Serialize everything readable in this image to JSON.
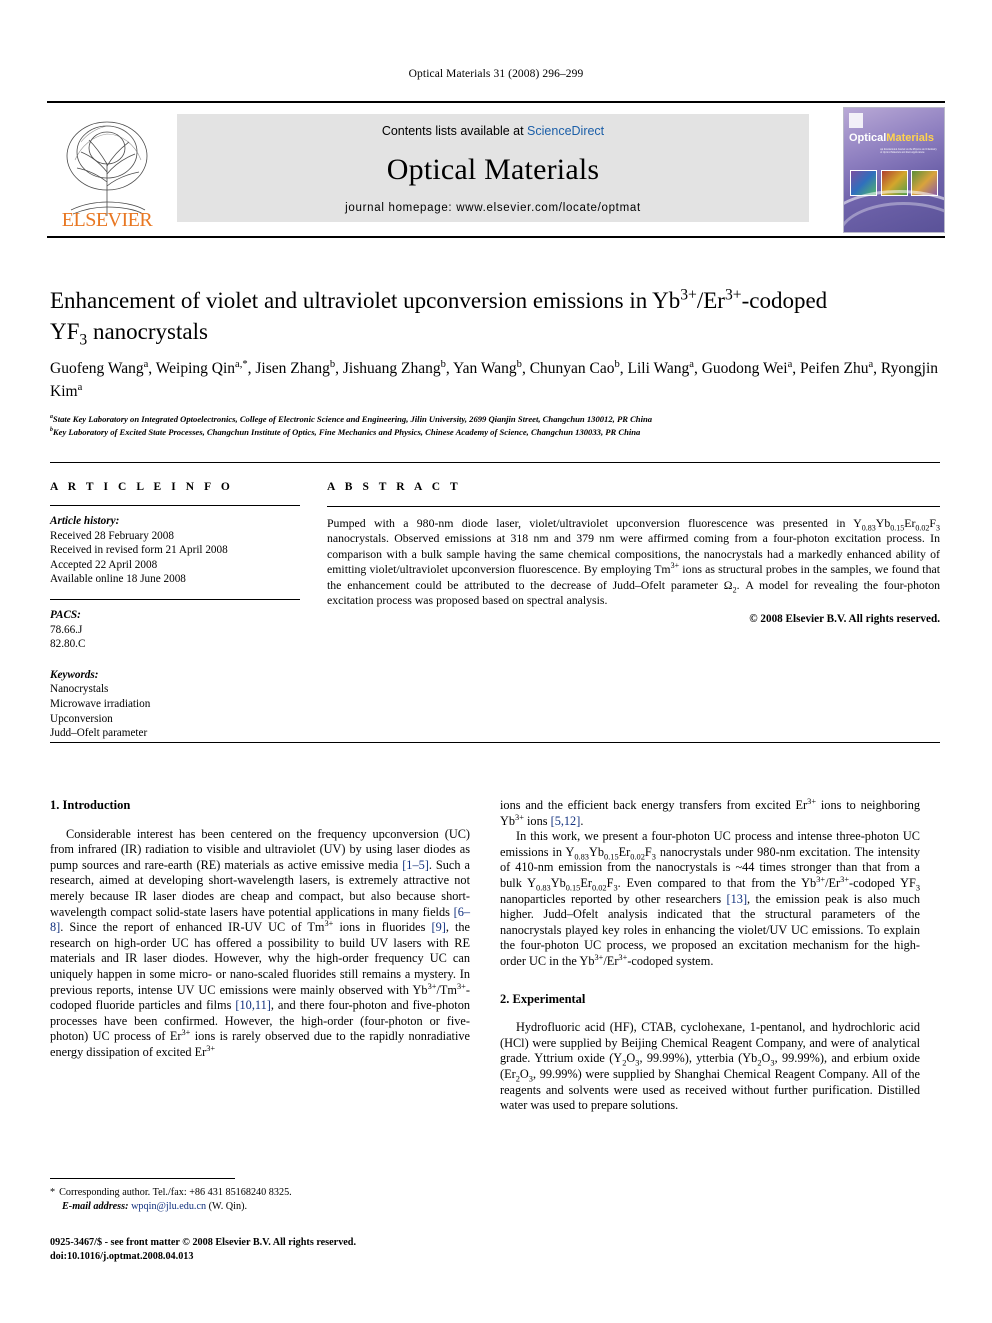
{
  "running_head": "Optical Materials 31 (2008) 296–299",
  "banner": {
    "contents_prefix": "Contents lists available at ",
    "sciencedirect": "ScienceDirect",
    "journal_name": "Optical Materials",
    "homepage": "journal homepage: www.elsevier.com/locate/optmat",
    "publisher_wordmark": "ELSEVIER",
    "cover": {
      "title_word1": "Optical",
      "title_word2": "Materials",
      "subtitle": "An International Journal on the Physics and Chemistry of Optical Materials and their Applications"
    },
    "colors": {
      "sciencedirect_blue": "#1c5fa8",
      "elsevier_orange": "#e87722",
      "contents_box_gray": "#e3e3e3",
      "cover_purple": "#6f63ab",
      "cover_yellow": "#ffd34d"
    }
  },
  "article": {
    "title_line1_a": "Enhancement of violet and ultraviolet upconversion emissions in Yb",
    "title_sup1": "3+",
    "title_line1_b": "/Er",
    "title_sup2": "3+",
    "title_line1_c": "-codoped",
    "title_line2_a": "YF",
    "title_sub1": "3",
    "title_line2_b": " nanocrystals",
    "authors": "Guofeng Wang a, Weiping Qin a,*, Jisen Zhang b, Jishuang Zhang b, Yan Wang b, Chunyan Cao b, Lili Wang a, Guodong Wei a, Peifen Zhu a, Ryongjin Kim a",
    "affiliation_a": "State Key Laboratory on Integrated Optoelectronics, College of Electronic Science and Engineering, Jilin University, 2699 Qianjin Street, Changchun 130012, PR China",
    "affiliation_b": "Key Laboratory of Excited State Processes, Changchun Institute of Optics, Fine Mechanics and Physics, Chinese Academy of Science, Changchun 130033, PR China",
    "affiliation_a_mark": "a",
    "affiliation_b_mark": "b"
  },
  "article_info": {
    "heading": "A R T I C L E   I N F O",
    "history_label": "Article history:",
    "history": [
      "Received 28 February 2008",
      "Received in revised form 21 April 2008",
      "Accepted 22 April 2008",
      "Available online 18 June 2008"
    ],
    "pacs_label": "PACS:",
    "pacs": [
      "78.66.J",
      "82.80.C"
    ],
    "keywords_label": "Keywords:",
    "keywords": [
      "Nanocrystals",
      "Microwave irradiation",
      "Upconversion",
      "Judd–Ofelt parameter"
    ]
  },
  "abstract": {
    "heading": "A B S T R A C T",
    "p1": "Pumped with a 980-nm diode laser, violet/ultraviolet upconversion fluorescence was presented in Y0.83Yb0.15Er0.02F3 nanocrystals. Observed emissions at 318 nm and 379 nm were affirmed coming from a four-photon excitation process. In comparison with a bulk sample having the same chemical compositions, the nanocrystals had a markedly enhanced ability of emitting violet/ultraviolet upconversion fluorescence. By employing Tm3+ ions as structural probes in the samples, we found that the enhancement could be attributed to the decrease of Judd–Ofelt parameter Ω2. A model for revealing the four-photon excitation process was proposed based on spectral analysis.",
    "copyright": "© 2008 Elsevier B.V. All rights reserved."
  },
  "sections": {
    "intro_heading": "1. Introduction",
    "intro_p1": "Considerable interest has been centered on the frequency upconversion (UC) from infrared (IR) radiation to visible and ultraviolet (UV) by using laser diodes as pump sources and rare-earth (RE) materials as active emissive media [1–5]. Such a research, aimed at developing short-wavelength lasers, is extremely attractive not merely because IR laser diodes are cheap and compact, but also because short-wavelength compact solid-state lasers have potential applications in many fields [6–8]. Since the report of enhanced IR-UV UC of Tm3+ ions in fluorides [9], the research on high-order UC has offered a possibility to build UV lasers with RE materials and IR laser diodes. However, why the high-order frequency UC can uniquely happen in some micro- or nano-scaled fluorides still remains a mystery. In previous reports, intense UV UC emissions were mainly observed with Yb3+/Tm3+-codoped fluoride particles and films [10,11], and there four-photon and five-photon processes have been confirmed. However, the high-order (four-photon or five-photon) UC process of Er3+ ions is rarely observed due to the rapidly nonradiative energy dissipation of excited Er3+ ions and the efficient back energy transfers from excited Er3+ ions to neighboring Yb3+ ions [5,12].",
    "intro_p2": "In this work, we present a four-photon UC process and intense three-photon UC emissions in Y0.83Yb0.15Er0.02F3 nanocrystals under 980-nm excitation. The intensity of 410-nm emission from the nanocrystals is ~44 times stronger than that from a bulk Y0.83Yb0.15Er0.02F3. Even compared to that from the Yb3+/Er3+-codoped YF3 nanoparticles reported by other researchers [13], the emission peak is also much higher. Judd–Ofelt analysis indicated that the structural parameters of the nanocrystals played key roles in enhancing the violet/UV UC emissions. To explain the four-photon UC process, we proposed an excitation mechanism for the high-order UC in the Yb3+/Er3+-codoped system.",
    "experimental_heading": "2. Experimental",
    "experimental_p1": "Hydrofluoric acid (HF), CTAB, cyclohexane, 1-pentanol, and hydrochloric acid (HCl) were supplied by Beijing Chemical Reagent Company, and were of analytical grade. Yttrium oxide (Y2O3, 99.99%), ytterbia (Yb2O3, 99.99%), and erbium oxide (Er2O3, 99.99%) were supplied by Shanghai Chemical Reagent Company. All of the reagents and solvents were used as received without further purification. Distilled water was used to prepare solutions."
  },
  "footnotes": {
    "corresponding_marker": "*",
    "corresponding": "Corresponding author. Tel./fax: +86 431 85168240 8325.",
    "email_label": "E-mail address:",
    "email": "wpqin@jlu.edu.cn",
    "email_suffix": "(W. Qin).",
    "issn": "0925-3467/$ - see front matter © 2008 Elsevier B.V. All rights reserved.",
    "doi": "doi:10.1016/j.optmat.2008.04.013"
  }
}
